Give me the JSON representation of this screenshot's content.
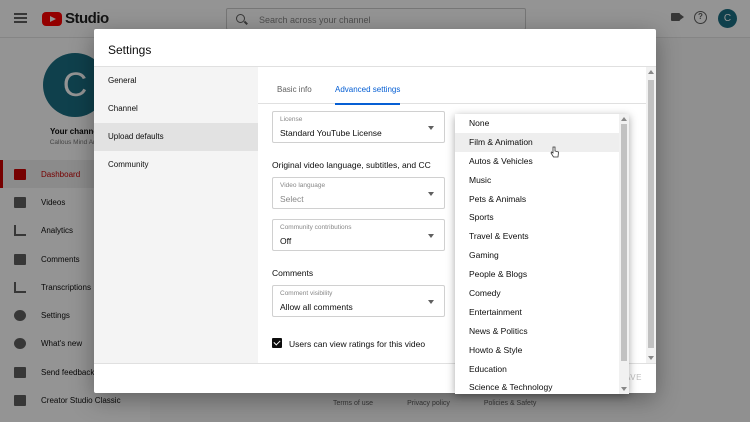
{
  "app": {
    "logo_text": "Studio",
    "search_placeholder": "Search across your channel",
    "avatar_letter": "C"
  },
  "sidebar": {
    "avatar_letter": "C",
    "channel_title": "Your channel",
    "channel_sub": "Callous Mind Ana",
    "items": [
      {
        "label": "Dashboard",
        "icon": "dashboard-icon"
      },
      {
        "label": "Videos",
        "icon": "videos-icon"
      },
      {
        "label": "Analytics",
        "icon": "analytics-icon"
      },
      {
        "label": "Comments",
        "icon": "comments-icon"
      },
      {
        "label": "Transcriptions",
        "icon": "transcriptions-icon"
      },
      {
        "label": "Settings",
        "icon": "settings-icon"
      },
      {
        "label": "What's new",
        "icon": "whats-new-icon"
      },
      {
        "label": "Send feedback",
        "icon": "feedback-icon"
      },
      {
        "label": "Creator Studio Classic",
        "icon": "classic-icon"
      }
    ]
  },
  "footer_links": [
    "Terms of use",
    "Privacy policy",
    "Policies & Safety"
  ],
  "dialog": {
    "title": "Settings",
    "nav": [
      "General",
      "Channel",
      "Upload defaults",
      "Community"
    ],
    "tabs": [
      "Basic info",
      "Advanced settings"
    ],
    "license": {
      "label": "License",
      "value": "Standard YouTube License"
    },
    "section_language": "Original video language, subtitles, and CC",
    "video_language": {
      "label": "Video language",
      "value": "Select"
    },
    "community": {
      "label": "Community contributions",
      "value": "Off"
    },
    "section_comments": "Comments",
    "comment_visibility": {
      "label": "Comment visibility",
      "value": "Allow all comments"
    },
    "ratings_checkbox": "Users can view ratings for this video",
    "save_label": "AVE"
  },
  "dropdown": {
    "options": [
      "None",
      "Film & Animation",
      "Autos & Vehicles",
      "Music",
      "Pets & Animals",
      "Sports",
      "Travel & Events",
      "Gaming",
      "People & Blogs",
      "Comedy",
      "Entertainment",
      "News & Politics",
      "Howto & Style",
      "Education",
      "Science & Technology"
    ],
    "highlighted": "Film & Animation"
  }
}
